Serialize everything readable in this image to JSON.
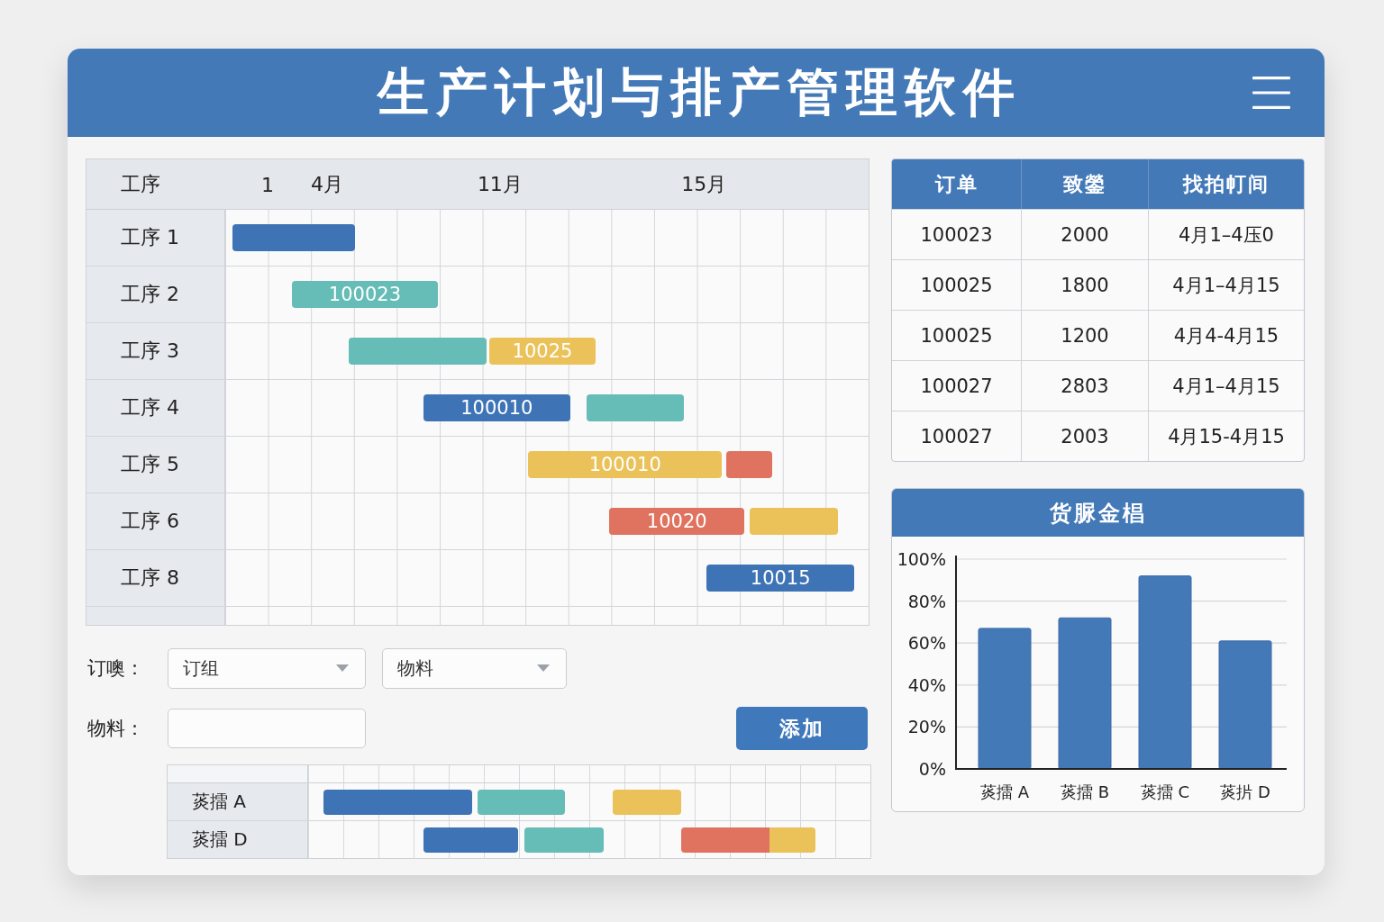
{
  "header": {
    "title": "生产计划与排产管理软件"
  },
  "gantt": {
    "corner_label": "工序",
    "timeline_labels": [
      "1",
      "4月",
      "11月",
      "15月"
    ],
    "rows": [
      {
        "label": "工序 1",
        "bars": [
          {
            "color": "#3e74b6"
          }
        ]
      },
      {
        "label": "工序 2",
        "bars": [
          {
            "color": "#66bcb7",
            "label": "100023"
          }
        ]
      },
      {
        "label": "工序 3",
        "bars": [
          {
            "color": "#66bcb7"
          },
          {
            "color": "#ebc25a",
            "label": "10025"
          }
        ]
      },
      {
        "label": "工序 4",
        "bars": [
          {
            "color": "#3e74b6",
            "label": "100010"
          },
          {
            "color": "#66bcb7"
          }
        ]
      },
      {
        "label": "工序 5",
        "bars": [
          {
            "color": "#ebc25a",
            "label": "100010"
          },
          {
            "color": "#e0735f"
          }
        ]
      },
      {
        "label": "工序 6",
        "bars": [
          {
            "color": "#e0735f",
            "label": "10020"
          },
          {
            "color": "#ebc25a"
          }
        ]
      },
      {
        "label": "工序 8",
        "bars": [
          {
            "color": "#3e74b6",
            "label": "10015"
          }
        ]
      }
    ]
  },
  "form": {
    "order_label": "订噢：",
    "order_select": {
      "value": "订组"
    },
    "material_select": {
      "value": "物料"
    },
    "material_label": "物料：",
    "add_button": {
      "label": "添加"
    }
  },
  "mini_gantt": {
    "rows": [
      {
        "label": "菼擂 A",
        "bars": [
          {
            "color": "#3e74b6"
          },
          {
            "color": "#66bcb7"
          },
          {
            "color": "#ebc25a"
          }
        ]
      },
      {
        "label": "菼擂 D",
        "bars": [
          {
            "color": "#3e74b6"
          },
          {
            "color": "#66bcb7"
          },
          {
            "color": "#e0735f"
          },
          {
            "color": "#ebc25a"
          }
        ]
      }
    ]
  },
  "orders_table": {
    "columns": [
      "订单",
      "致鎣",
      "找拍帄间"
    ],
    "rows": [
      [
        "100023",
        "2000",
        "4月1–4压0"
      ],
      [
        "100025",
        "1800",
        "4月1–4月15"
      ],
      [
        "100025",
        "1200",
        "4月4-4月15"
      ],
      [
        "100027",
        "2803",
        "4月1–4月15"
      ],
      [
        "100027",
        "2003",
        "4月15-4月15"
      ]
    ]
  },
  "chart": {
    "chart_data": {
      "type": "bar",
      "title": "货脲金椙",
      "categories": [
        "菼擂 A",
        "菼擂 B",
        "菼擂 C",
        "菼扸 D"
      ],
      "values": [
        67,
        72,
        92,
        61
      ],
      "ylim": [
        0,
        100
      ],
      "yticks": [
        {
          "value": 0,
          "label": "0%"
        },
        {
          "value": 20,
          "label": "20%"
        },
        {
          "value": 40,
          "label": "40%"
        },
        {
          "value": 60,
          "label": "60%"
        },
        {
          "value": 80,
          "label": "80%"
        },
        {
          "value": 100,
          "label": "100%"
        }
      ],
      "grid": true
    }
  }
}
